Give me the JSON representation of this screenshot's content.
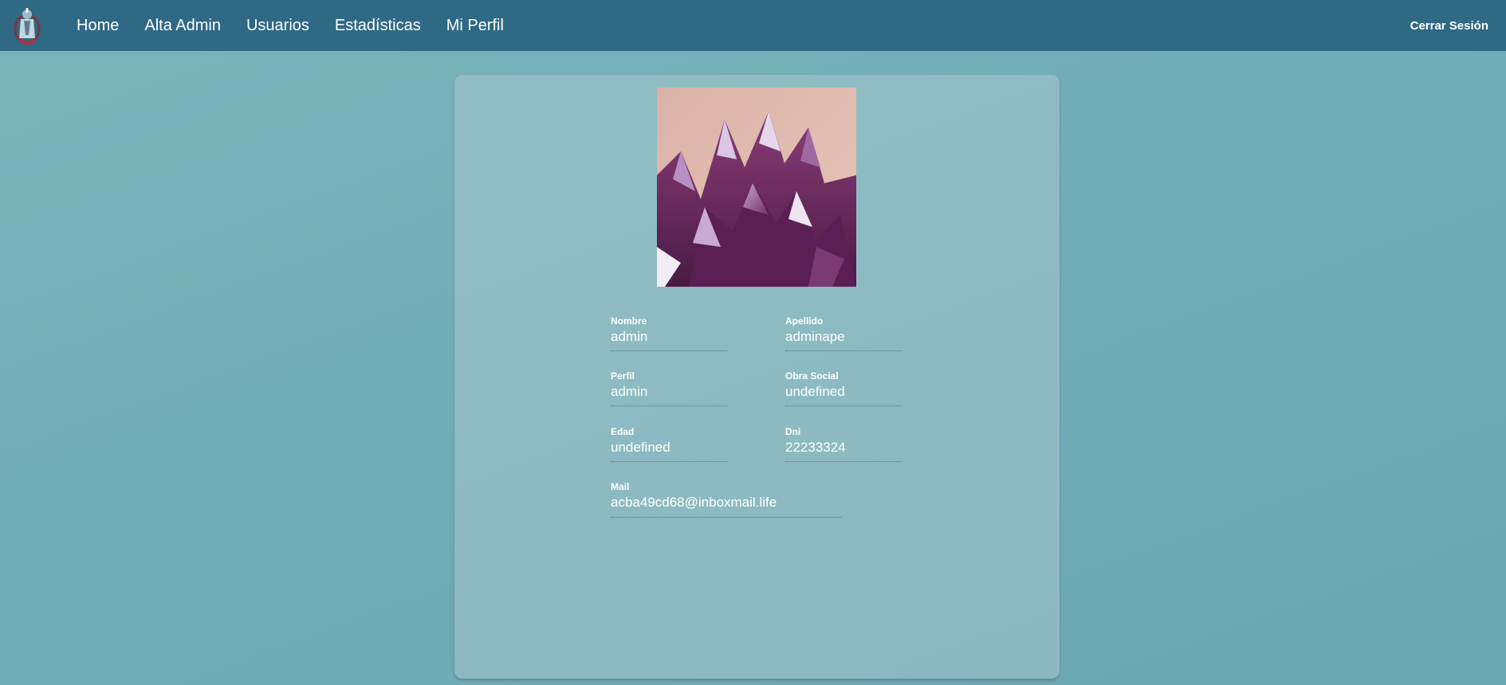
{
  "colors": {
    "navbar": "#2f6985",
    "background": "#70adb5",
    "card": "#a0c4ca",
    "text": "#ffffff"
  },
  "navbar": {
    "logo_icon": "medical-logo-icon",
    "links": [
      {
        "label": "Home"
      },
      {
        "label": "Alta Admin"
      },
      {
        "label": "Usuarios"
      },
      {
        "label": "Estadísticas"
      },
      {
        "label": "Mi Perfil"
      }
    ],
    "logout_label": "Cerrar Sesión"
  },
  "profile": {
    "photo_icon": "profile-photo-amethyst",
    "fields": {
      "nombre": {
        "label": "Nombre",
        "value": "admin"
      },
      "apellido": {
        "label": "Apellido",
        "value": "adminape"
      },
      "perfil": {
        "label": "Perfil",
        "value": "admin"
      },
      "obra_social": {
        "label": "Obra Social",
        "value": "undefined"
      },
      "edad": {
        "label": "Edad",
        "value": "undefined"
      },
      "dni": {
        "label": "Dni",
        "value": "22233324"
      },
      "mail": {
        "label": "Mail",
        "value": "acba49cd68@inboxmail.life"
      }
    }
  }
}
